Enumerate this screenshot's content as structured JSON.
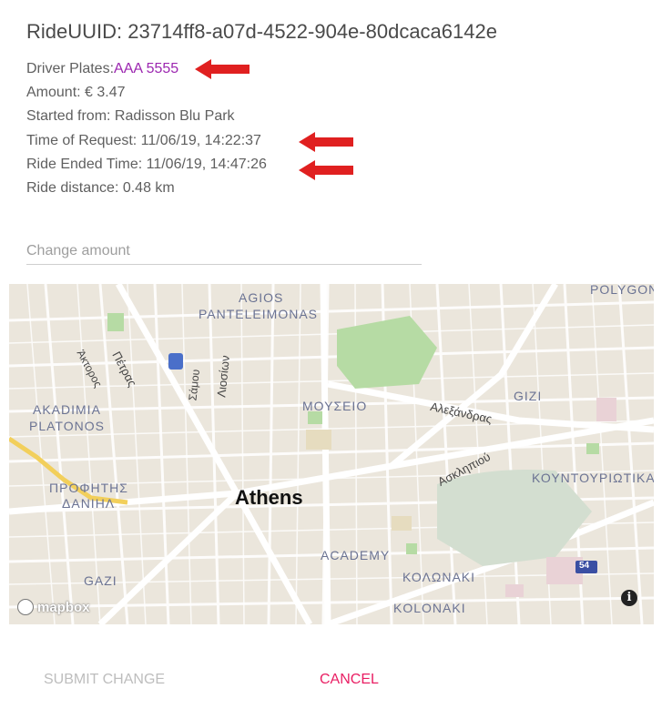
{
  "ride": {
    "uuid_label": "RideUUID: 23714ff8-a07d-4522-904e-80dcaca6142e",
    "plates_label": "Driver Plates:",
    "plates_value": "AAA 5555",
    "amount": "Amount: € 3.47",
    "started_from": "Started from: Radisson Blu Park",
    "time_of_request": "Time of Request: 11/06/19, 14:22:37",
    "ride_ended": "Ride Ended Time: 11/06/19, 14:47:26",
    "distance": "Ride distance: 0.48 km"
  },
  "form": {
    "change_amount_placeholder": "Change amount",
    "change_amount_value": ""
  },
  "map": {
    "labels": {
      "agios": "AGIOS",
      "panteleimonas": "PANTELEIMONAS",
      "polygon": "POLYGON",
      "akadimia": "AKADIMIA",
      "platonos": "PLATONOS",
      "mouseio": "ΜΟΥΣΕΙΟ",
      "gizi": "GIZI",
      "alexandras": "Αλεξάνδρας",
      "asklipiou": "Ασκληπιού",
      "kountouriotika": "ΚΟΥΝΤΟΥΡΙΩΤΙΚΑ",
      "profitis": "ΠΡΟΦΗΤΗΣ",
      "danil": "ΔΑΝΙΗΛ",
      "athens": "Athens",
      "academy": "ACADEMY",
      "kolonaki_gr": "ΚΟΛΩΝΑΚΙ",
      "kolonaki": "KOLONAKI",
      "gazi": "GAZI",
      "petras": "Πέτρας",
      "aktorous": "Άκτορος",
      "liosion": "Λιοσίων",
      "samou": "Σάμου",
      "route": "54"
    },
    "attribution": "mapbox",
    "info_glyph": "i"
  },
  "actions": {
    "submit": "SUBMIT CHANGE",
    "cancel": "CANCEL"
  },
  "colors": {
    "accent": "#e91e63",
    "plates": "#9c27b0",
    "arrow": "#e02020",
    "disabled": "#bdbdbd"
  }
}
